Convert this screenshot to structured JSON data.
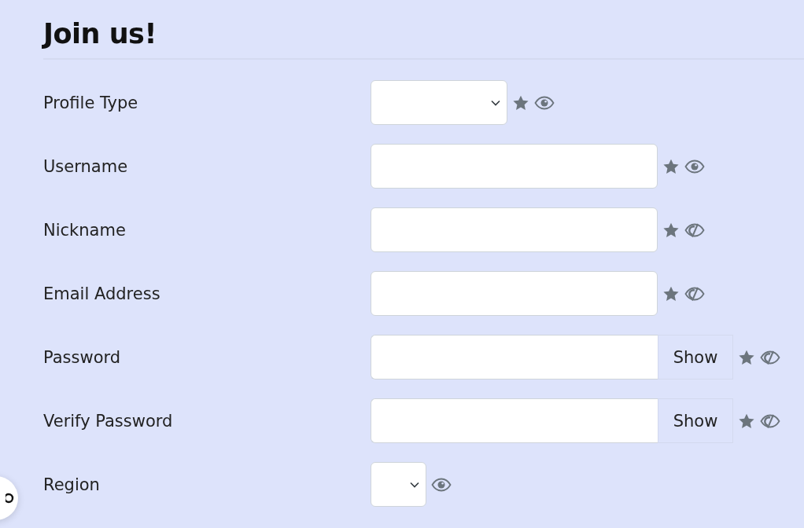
{
  "title": "Join us!",
  "fields": [
    {
      "label": "Profile Type",
      "kind": "select",
      "compact": false,
      "required": true,
      "visible": true
    },
    {
      "label": "Username",
      "kind": "text",
      "required": true,
      "visible": true
    },
    {
      "label": "Nickname",
      "kind": "text",
      "required": true,
      "visible": false
    },
    {
      "label": "Email Address",
      "kind": "text",
      "required": true,
      "visible": false
    },
    {
      "label": "Password",
      "kind": "password",
      "button": "Show",
      "required": true,
      "visible": false
    },
    {
      "label": "Verify Password",
      "kind": "password",
      "button": "Show",
      "required": true,
      "visible": false
    },
    {
      "label": "Region",
      "kind": "select",
      "compact": true,
      "required": false,
      "visible": true
    }
  ]
}
